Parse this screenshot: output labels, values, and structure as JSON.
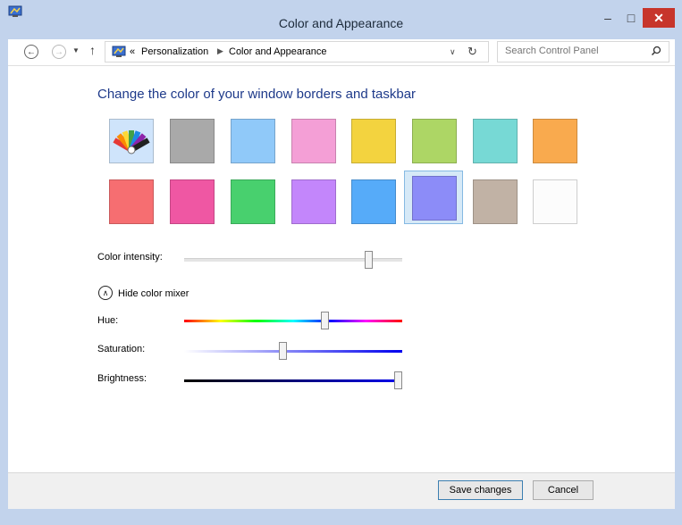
{
  "window": {
    "title": "Color and Appearance",
    "minimize_glyph": "–",
    "maximize_glyph": "□",
    "close_glyph": "✕"
  },
  "address_bar": {
    "back_glyph": "←",
    "forward_glyph": "→",
    "recent_glyph": "▼",
    "up_glyph": "↑",
    "overflow_glyph": "«",
    "breadcrumb": [
      "Personalization",
      "Color and Appearance"
    ],
    "separator_glyph": "▶",
    "dropdown_glyph": "∨",
    "refresh_glyph": "↻",
    "search_placeholder": "Search Control Panel"
  },
  "main": {
    "heading": "Change the color of your window borders and taskbar",
    "swatches_row1": [
      {
        "name": "automatic",
        "color": "#cfe4fb"
      },
      {
        "name": "gray",
        "color": "#a9a9a9"
      },
      {
        "name": "sky-blue",
        "color": "#90c9f9"
      },
      {
        "name": "pink",
        "color": "#f49fd6"
      },
      {
        "name": "yellow",
        "color": "#f3d33f"
      },
      {
        "name": "lime",
        "color": "#add665"
      },
      {
        "name": "teal",
        "color": "#77d9d5"
      },
      {
        "name": "orange",
        "color": "#f9aa4e"
      }
    ],
    "swatches_row2": [
      {
        "name": "red",
        "color": "#f66e71"
      },
      {
        "name": "magenta",
        "color": "#ef57a3"
      },
      {
        "name": "green",
        "color": "#48d06e"
      },
      {
        "name": "violet",
        "color": "#c386fb"
      },
      {
        "name": "blue",
        "color": "#56abf9"
      },
      {
        "name": "periwinkle",
        "color": "#8c8cf8"
      },
      {
        "name": "taupe",
        "color": "#c1b2a5"
      },
      {
        "name": "white",
        "color": "#fcfcfc"
      }
    ],
    "selected_swatch": "periwinkle",
    "color_intensity": {
      "label": "Color intensity:",
      "value": 0.86
    },
    "mixer_toggle": {
      "label": "Hide color mixer",
      "glyph": "∧"
    },
    "hue": {
      "label": "Hue:",
      "value": 0.65
    },
    "saturation": {
      "label": "Saturation:",
      "value": 0.45
    },
    "brightness": {
      "label": "Brightness:",
      "value": 1.0
    }
  },
  "footer": {
    "save_label": "Save changes",
    "cancel_label": "Cancel"
  },
  "colors": {
    "chrome": "#c2d3ec",
    "heading": "#1e3a8a",
    "close_button": "#c7352b",
    "selection": "#d6e9f7"
  }
}
